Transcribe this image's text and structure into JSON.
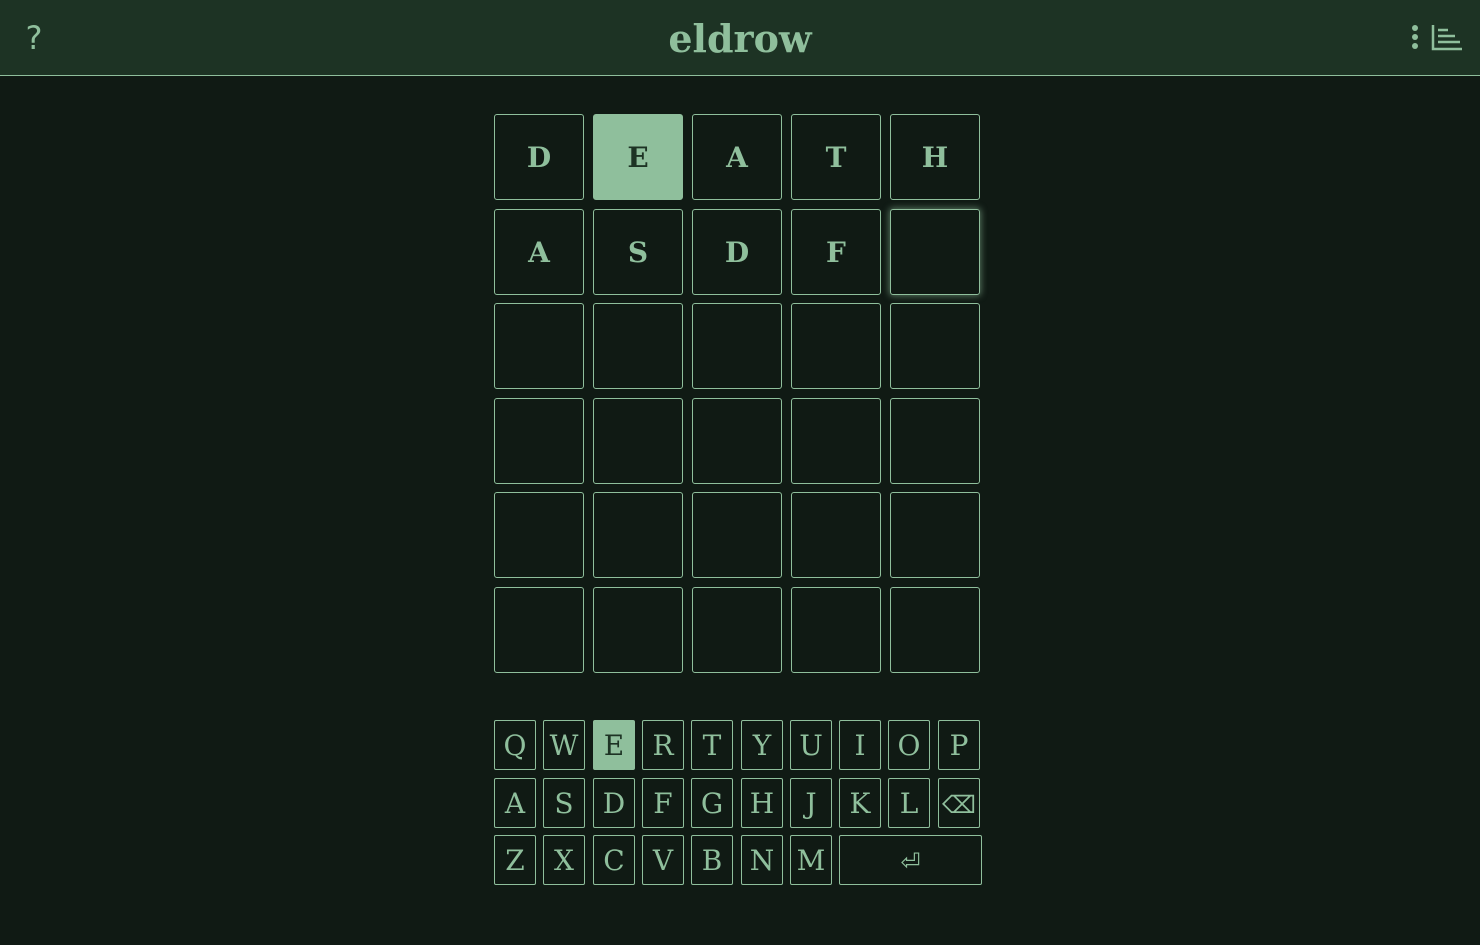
{
  "header": {
    "title": "eldrow",
    "help_label": "?"
  },
  "icons": {
    "help": "question-mark-icon",
    "menu": "vertical-dots-icon",
    "stats": "bar-chart-icon",
    "backspace": "backspace-icon",
    "enter": "enter-icon"
  },
  "colors": {
    "background": "#101a14",
    "header": "#1d3324",
    "accent": "#8fbf9c"
  },
  "board": {
    "rows": [
      [
        {
          "letter": "D",
          "state": "empty"
        },
        {
          "letter": "E",
          "state": "correct"
        },
        {
          "letter": "A",
          "state": "empty"
        },
        {
          "letter": "T",
          "state": "empty"
        },
        {
          "letter": "H",
          "state": "empty"
        }
      ],
      [
        {
          "letter": "A",
          "state": "empty"
        },
        {
          "letter": "S",
          "state": "empty"
        },
        {
          "letter": "D",
          "state": "empty"
        },
        {
          "letter": "F",
          "state": "empty"
        },
        {
          "letter": "",
          "state": "active"
        }
      ],
      [
        {
          "letter": "",
          "state": "empty"
        },
        {
          "letter": "",
          "state": "empty"
        },
        {
          "letter": "",
          "state": "empty"
        },
        {
          "letter": "",
          "state": "empty"
        },
        {
          "letter": "",
          "state": "empty"
        }
      ],
      [
        {
          "letter": "",
          "state": "empty"
        },
        {
          "letter": "",
          "state": "empty"
        },
        {
          "letter": "",
          "state": "empty"
        },
        {
          "letter": "",
          "state": "empty"
        },
        {
          "letter": "",
          "state": "empty"
        }
      ],
      [
        {
          "letter": "",
          "state": "empty"
        },
        {
          "letter": "",
          "state": "empty"
        },
        {
          "letter": "",
          "state": "empty"
        },
        {
          "letter": "",
          "state": "empty"
        },
        {
          "letter": "",
          "state": "empty"
        }
      ],
      [
        {
          "letter": "",
          "state": "empty"
        },
        {
          "letter": "",
          "state": "empty"
        },
        {
          "letter": "",
          "state": "empty"
        },
        {
          "letter": "",
          "state": "empty"
        },
        {
          "letter": "",
          "state": "empty"
        }
      ]
    ]
  },
  "keyboard": {
    "rows": [
      [
        {
          "label": "Q"
        },
        {
          "label": "W"
        },
        {
          "label": "E",
          "state": "correct"
        },
        {
          "label": "R"
        },
        {
          "label": "T"
        },
        {
          "label": "Y"
        },
        {
          "label": "U"
        },
        {
          "label": "I"
        },
        {
          "label": "O"
        },
        {
          "label": "P"
        }
      ],
      [
        {
          "label": "A"
        },
        {
          "label": "S"
        },
        {
          "label": "D"
        },
        {
          "label": "F"
        },
        {
          "label": "G"
        },
        {
          "label": "H"
        },
        {
          "label": "J"
        },
        {
          "label": "K"
        },
        {
          "label": "L"
        },
        {
          "label": "⌫",
          "action": "backspace"
        }
      ],
      [
        {
          "label": "Z"
        },
        {
          "label": "X"
        },
        {
          "label": "C"
        },
        {
          "label": "V"
        },
        {
          "label": "B"
        },
        {
          "label": "N"
        },
        {
          "label": "M"
        },
        {
          "label": "⏎",
          "action": "enter"
        }
      ]
    ]
  }
}
